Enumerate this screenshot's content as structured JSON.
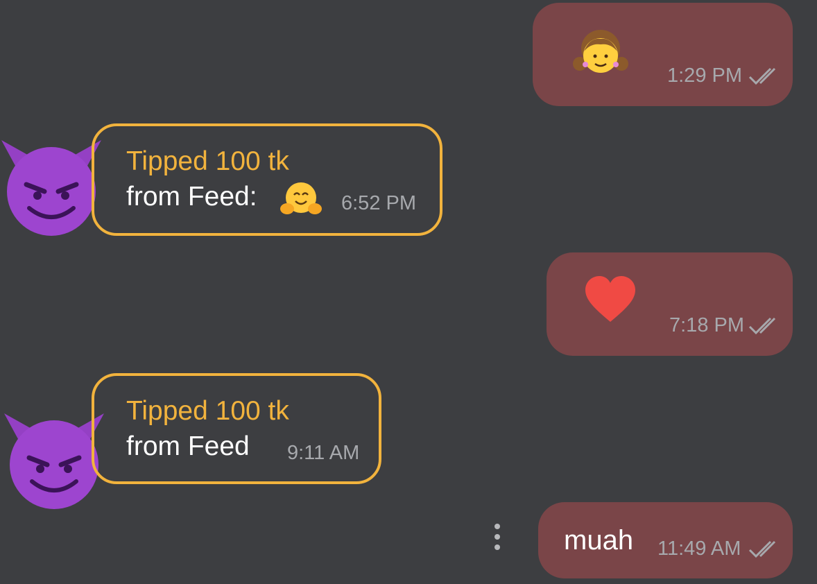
{
  "messages": [
    {
      "side": "outgoing",
      "content_icon": "girl-emoji-icon",
      "time": "1:29 PM",
      "status_icon": "double-check-icon"
    },
    {
      "side": "incoming",
      "sender_icon": "smiling-devil-emoji-icon",
      "title": "Tipped 100 tk",
      "text": "from Feed:",
      "content_icon": "hugging-face-emoji-icon",
      "time": "6:52 PM"
    },
    {
      "side": "outgoing",
      "content_icon": "red-heart-emoji-icon",
      "time": "7:18 PM",
      "status_icon": "double-check-icon"
    },
    {
      "side": "incoming",
      "sender_icon": "smiling-devil-emoji-icon",
      "title": "Tipped 100 tk",
      "text": "from Feed",
      "time": "9:11 AM"
    },
    {
      "side": "outgoing",
      "text": "muah",
      "time": "11:49 AM",
      "status_icon": "double-check-icon"
    }
  ],
  "menu_icon": "more-vertical-icon",
  "colors": {
    "background": "#3d3e41",
    "outgoing_bubble": "#7a4548",
    "tip_accent": "#f2b33d",
    "timestamp": "#a7a9ad"
  }
}
